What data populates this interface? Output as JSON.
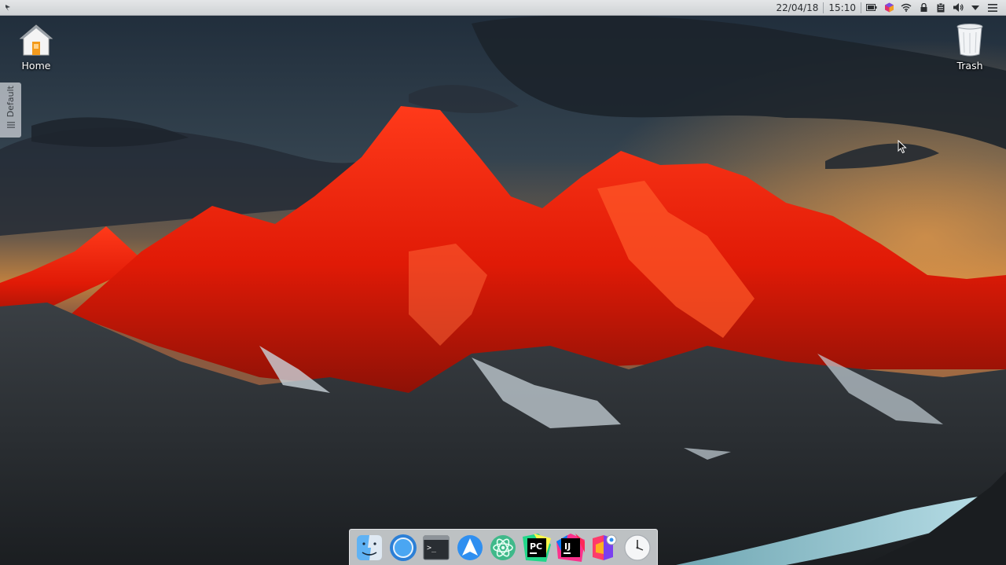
{
  "panel": {
    "date": "22/04/18",
    "time": "15:10",
    "tray_icons": [
      "battery-icon",
      "app-indicator-icon",
      "wifi-icon",
      "lock-icon",
      "clipboard-icon",
      "volume-icon",
      "arrow-down-icon",
      "menu-icon"
    ]
  },
  "desktop": {
    "home_label": "Home",
    "trash_label": "Trash",
    "activity_tab_label": "Default"
  },
  "dock": {
    "items": [
      {
        "name": "finder-icon"
      },
      {
        "name": "browser-icon"
      },
      {
        "name": "terminal-icon",
        "glyph": ">_"
      },
      {
        "name": "arrow-launcher-icon"
      },
      {
        "name": "atom-icon"
      },
      {
        "name": "pycharm-icon",
        "glyph": "PC"
      },
      {
        "name": "intellij-icon",
        "glyph": "IJ"
      },
      {
        "name": "color-picker-icon"
      },
      {
        "name": "clock-icon"
      }
    ]
  },
  "colors": {
    "panel_bg": "#d8dbde",
    "accent": "#3daee9"
  }
}
